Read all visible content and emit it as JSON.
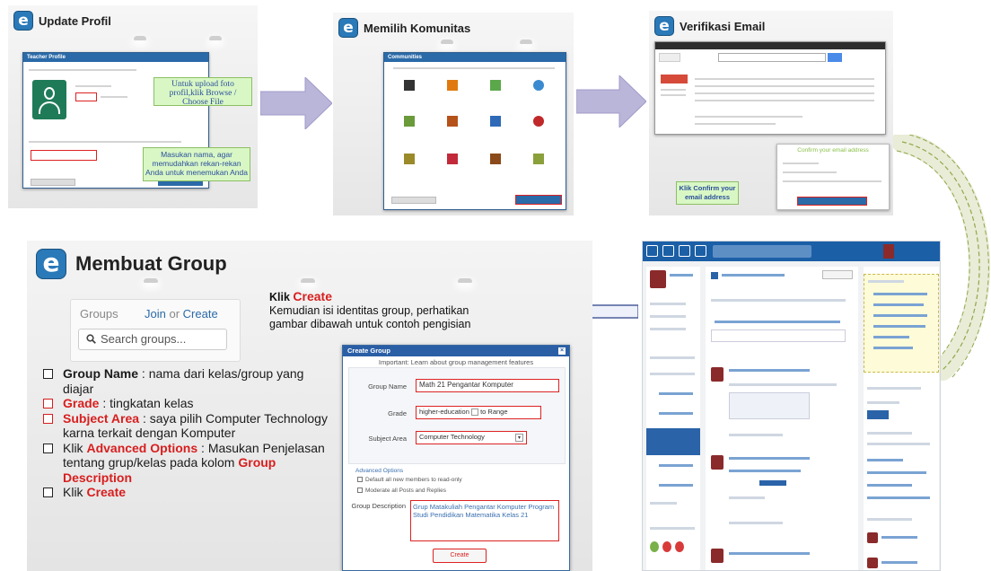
{
  "colors": {
    "accent": "#2a79b8",
    "highlight": "#d81e1e",
    "callout_bg": "#d9f7c5",
    "arrow": "#b7b3d8"
  },
  "steps": [
    {
      "logo": "e",
      "title": "Update Profil",
      "window_title": "Teacher Profile",
      "callout_upload": "Untuk upload foto profil,klik Browse / Choose File",
      "callout_name": "Masukan nama, agar memudahkan rekan-rekan Anda untuk menemukan Anda"
    },
    {
      "logo": "e",
      "title": "Memilih Komunitas",
      "window_title": "Communities"
    },
    {
      "logo": "e",
      "title": "Verifikasi Email",
      "callout_confirm": "Klik Confirm your email address",
      "email_heading": "Confirm your email address"
    }
  ],
  "main": {
    "logo": "e",
    "title": "Membuat Group",
    "groups_widget": {
      "groups_label": "Groups",
      "join_label": "Join",
      "or_label": "or",
      "create_label": "Create",
      "search_placeholder": "Search groups..."
    },
    "instruction": {
      "klik": "Klik",
      "create": "Create",
      "line2": "Kemudian isi identitas group, perhatikan",
      "line3": "gambar dibawah untuk contoh pengisian"
    },
    "list": [
      {
        "term": "Group Name",
        "sep": " : ",
        "text": "nama dari kelas/group yang diajar"
      },
      {
        "term": "Grade",
        "sep": " : ",
        "text": "tingkatan kelas"
      },
      {
        "term": "Subject Area",
        "sep": " : ",
        "text": "saya pilih Computer Technology karna terkait dengan Komputer"
      },
      {
        "prefix": "Klik ",
        "term": "Advanced Options",
        "sep": " :",
        "text": "Masukan Penjelasan tentang grup/kelas pada kolom ",
        "term2": "Group Description"
      },
      {
        "prefix": "Klik ",
        "term": "Create"
      }
    ],
    "dialog": {
      "title": "Create Group",
      "subtitle": "Important: Learn about group management features",
      "group_name_label": "Group Name",
      "group_name_value": "Math 21 Pengantar Komputer",
      "grade_label": "Grade",
      "grade_value": "higher-education",
      "grade_to": "to",
      "grade_to_value": "Range",
      "subject_label": "Subject Area",
      "subject_value": "Computer Technology",
      "advanced": "Advanced Options",
      "opt1": "Default all new members to read-only",
      "opt2": "Moderate all Posts and Replies",
      "desc_label": "Group Description",
      "desc_value": "Grup Matakuliah Pengantar Komputer Program Studi Pendidikan Matematika Kelas 21",
      "create_button": "Create"
    }
  }
}
